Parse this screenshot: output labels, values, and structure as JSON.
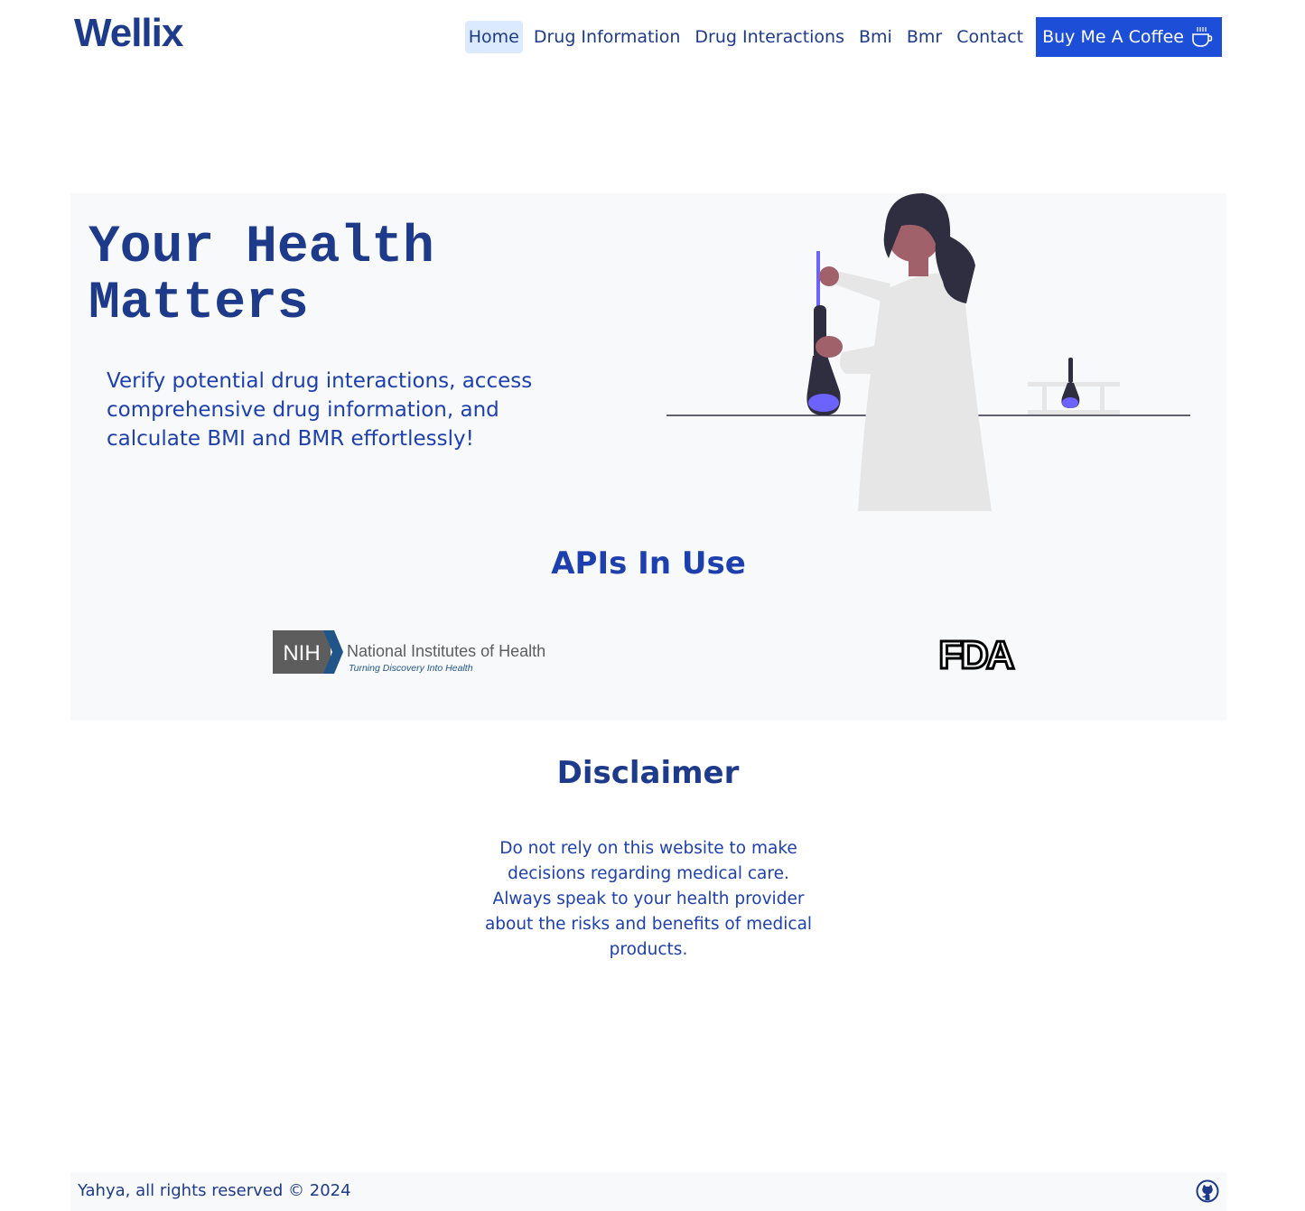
{
  "nav": {
    "brand": "Wellix",
    "links": [
      {
        "label": "Home",
        "active": true
      },
      {
        "label": "Drug Information"
      },
      {
        "label": "Drug Interactions"
      },
      {
        "label": "Bmi"
      },
      {
        "label": "Bmr"
      },
      {
        "label": "Contact"
      }
    ],
    "coffee_label": "Buy Me A Coffee",
    "coffee_icon": "coffee-cup-icon"
  },
  "hero": {
    "title_line1": "Your Health",
    "title_line2": "Matters",
    "subtitle": "Verify potential drug interactions, access comprehensive drug information, and calculate BMI and BMR effortlessly!"
  },
  "apis": {
    "title": "APIs In Use",
    "nih": {
      "abbr": "NIH",
      "name": "National Institutes of Health",
      "tagline": "Turning Discovery Into Health"
    },
    "fda": {
      "abbr": "FDA"
    }
  },
  "disclaimer": {
    "title": "Disclaimer",
    "text": "Do not rely on this website to make decisions regarding medical care. Always speak to your health provider about the risks and benefits of medical products."
  },
  "footer": {
    "text": "Yahya, all rights reserved © 2024",
    "icon": "github-icon"
  },
  "colors": {
    "primary": "#1e3a8a",
    "button": "#1d4ed8",
    "active_bg": "#dbeafe",
    "section_bg": "#f8f9fb",
    "accent_purple": "#6c63ff"
  }
}
